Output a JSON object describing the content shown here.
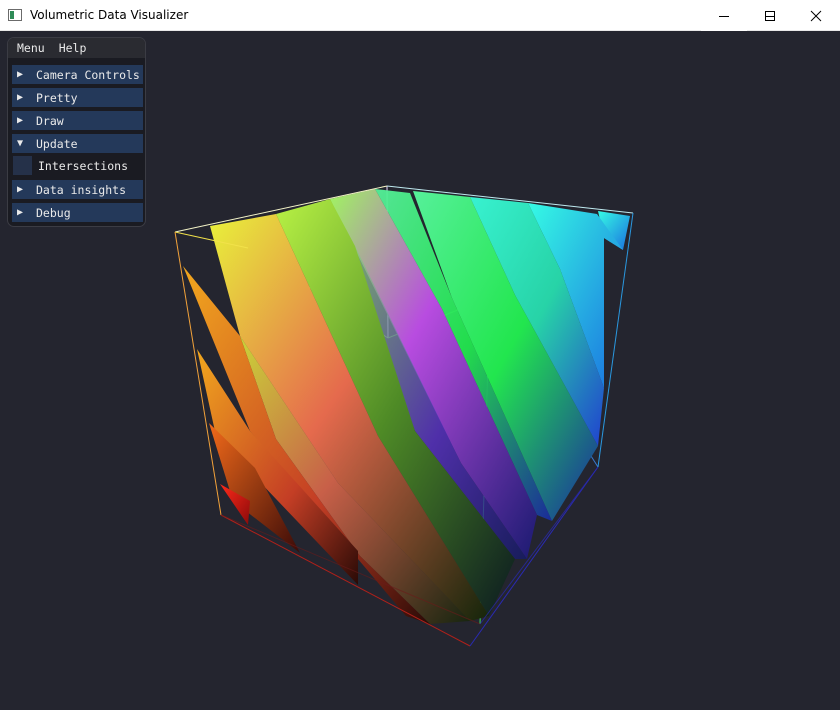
{
  "window": {
    "title": "Volumetric Data Visualizer",
    "buttons": [
      "minimize",
      "maximize",
      "close"
    ]
  },
  "panel": {
    "menu": [
      {
        "label": "Menu"
      },
      {
        "label": "Help"
      }
    ],
    "sections": [
      {
        "label": "Camera Controls",
        "arrow": "▶",
        "expanded": false
      },
      {
        "label": "Pretty",
        "arrow": "▶",
        "expanded": false
      },
      {
        "label": "Draw",
        "arrow": "▶",
        "expanded": false
      },
      {
        "label": "Update",
        "arrow": "▼",
        "expanded": true
      },
      {
        "label": "Data insights",
        "arrow": "▶",
        "expanded": false
      },
      {
        "label": "Debug",
        "arrow": "▶",
        "expanded": false
      }
    ],
    "intersections": {
      "label": "Intersections",
      "checked": false
    }
  },
  "colors": {
    "viewport_bg": "#24252f",
    "panel_bg": "#1a1b22",
    "header_bg": "#24395a",
    "checkbox_bg": "#253149"
  }
}
